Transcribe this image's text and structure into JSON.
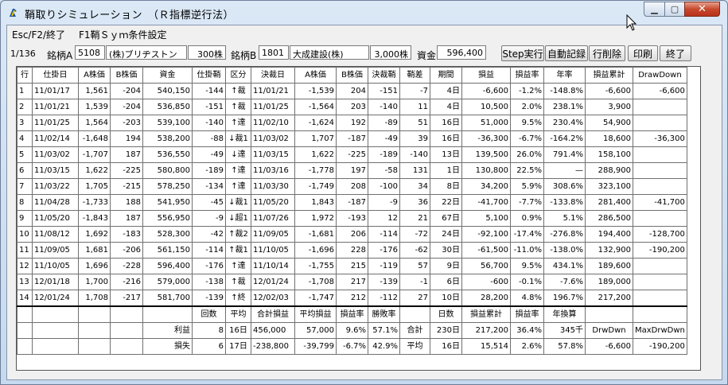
{
  "window": {
    "title": "鞘取りシミュレーション　（Ｒ指標逆行法）",
    "minimize_glyph": "▁",
    "maximize_glyph": "▢",
    "close_glyph": "✕"
  },
  "menu": {
    "items": [
      "Esc/F2/終了",
      "F1鞘Ｓｙｍ条件設定"
    ]
  },
  "info": {
    "counter": "1/136",
    "stock_a_label": "銘柄A",
    "stock_a_code": "5108",
    "stock_a_name": "(株)ブリヂストン",
    "stock_a_shares": "300株",
    "stock_b_label": "銘柄B",
    "stock_b_code": "1801",
    "stock_b_name": "大成建設(株)",
    "stock_b_shares": "3,000株",
    "capital_label": "資金",
    "capital_value": "596,400"
  },
  "toolbar": {
    "step": "Step実行",
    "auto": "自動記録",
    "delete_row": "行削除",
    "print": "印刷",
    "quit": "終了"
  },
  "table": {
    "headers": [
      "行",
      "仕掛日",
      "A株価",
      "B株価",
      "資金",
      "仕掛鞘",
      "区分",
      "決裁日",
      "A株価",
      "B株価",
      "決裁鞘",
      "鞘差",
      "期間",
      "損益",
      "損益率",
      "年率",
      "損益累計",
      "DrawDown"
    ],
    "rows": [
      [
        "1",
        "11/01/17",
        "1,561",
        "-204",
        "540,150",
        "-144",
        "↑裁",
        "11/01/21",
        "-1,539",
        "204",
        "-151",
        "-7",
        "4日",
        "-6,600",
        "-1.2%",
        "-148.8%",
        "-6,600",
        "-6,600"
      ],
      [
        "2",
        "11/01/21",
        "1,539",
        "-204",
        "536,850",
        "-151",
        "↑裁",
        "11/01/25",
        "-1,564",
        "203",
        "-140",
        "11",
        "4日",
        "10,500",
        "2.0%",
        "238.1%",
        "3,900",
        ""
      ],
      [
        "3",
        "11/01/25",
        "1,564",
        "-203",
        "539,100",
        "-140",
        "↑達",
        "11/02/10",
        "-1,624",
        "192",
        "-89",
        "51",
        "16日",
        "51,000",
        "9.5%",
        "230.4%",
        "54,900",
        ""
      ],
      [
        "4",
        "11/02/14",
        "-1,648",
        "194",
        "538,200",
        "-88",
        "↓裁1",
        "11/03/02",
        "1,707",
        "-187",
        "-49",
        "39",
        "16日",
        "-36,300",
        "-6.7%",
        "-164.2%",
        "18,600",
        "-36,300"
      ],
      [
        "5",
        "11/03/02",
        "-1,707",
        "187",
        "536,550",
        "-49",
        "↓達",
        "11/03/15",
        "1,622",
        "-225",
        "-189",
        "-140",
        "13日",
        "139,500",
        "26.0%",
        "791.4%",
        "158,100",
        ""
      ],
      [
        "6",
        "11/03/15",
        "1,622",
        "-225",
        "580,800",
        "-189",
        "↑達",
        "11/03/16",
        "-1,778",
        "197",
        "-58",
        "131",
        "1日",
        "130,800",
        "22.5%",
        "—",
        "288,900",
        ""
      ],
      [
        "7",
        "11/03/22",
        "1,705",
        "-215",
        "578,250",
        "-134",
        "↑達",
        "11/03/30",
        "-1,749",
        "208",
        "-100",
        "34",
        "8日",
        "34,200",
        "5.9%",
        "308.6%",
        "323,100",
        ""
      ],
      [
        "8",
        "11/04/28",
        "-1,733",
        "188",
        "541,950",
        "-45",
        "↓裁1",
        "11/05/20",
        "1,843",
        "-187",
        "-9",
        "36",
        "22日",
        "-41,700",
        "-7.7%",
        "-133.8%",
        "281,400",
        "-41,700"
      ],
      [
        "9",
        "11/05/20",
        "-1,843",
        "187",
        "556,950",
        "-9",
        "↓超1",
        "11/07/26",
        "1,972",
        "-193",
        "12",
        "21",
        "67日",
        "5,100",
        "0.9%",
        "5.1%",
        "286,500",
        ""
      ],
      [
        "10",
        "11/08/12",
        "1,692",
        "-183",
        "528,300",
        "-42",
        "↑裁2",
        "11/09/05",
        "-1,681",
        "206",
        "-114",
        "-72",
        "24日",
        "-92,100",
        "-17.4%",
        "-276.8%",
        "194,400",
        "-128,700"
      ],
      [
        "11",
        "11/09/05",
        "1,681",
        "-206",
        "561,150",
        "-114",
        "↑裁1",
        "11/10/05",
        "-1,696",
        "228",
        "-176",
        "-62",
        "30日",
        "-61,500",
        "-11.0%",
        "-138.0%",
        "132,900",
        "-190,200"
      ],
      [
        "12",
        "11/10/05",
        "1,696",
        "-228",
        "596,400",
        "-176",
        "↑達",
        "11/10/14",
        "-1,755",
        "215",
        "-119",
        "57",
        "9日",
        "56,700",
        "9.5%",
        "434.1%",
        "189,600",
        ""
      ],
      [
        "13",
        "12/01/18",
        "1,700",
        "-216",
        "579,000",
        "-138",
        "↑裁",
        "12/01/24",
        "-1,708",
        "217",
        "-139",
        "-1",
        "6日",
        "-600",
        "-0.1%",
        "-7.6%",
        "189,000",
        ""
      ],
      [
        "14",
        "12/01/24",
        "1,708",
        "-217",
        "581,700",
        "-139",
        "↑終",
        "12/02/03",
        "-1,747",
        "212",
        "-112",
        "27",
        "10日",
        "28,200",
        "4.8%",
        "196.7%",
        "217,200",
        ""
      ]
    ],
    "summary_header": [
      "",
      "",
      "",
      "",
      "",
      "回数",
      "平均",
      "合計損益",
      "平均損益",
      "損益率",
      "勝敗率",
      "",
      "日数",
      "損益累計",
      "損益率",
      "年換算",
      "",
      ""
    ],
    "summary_profit": [
      "",
      "",
      "",
      "",
      "利益",
      "8",
      "16日",
      "456,000",
      "57,000",
      "9.6%",
      "57.1%",
      "合計",
      "230日",
      "217,200",
      "36.4%",
      "345千",
      "DrwDwn",
      "MaxDrwDwn"
    ],
    "summary_loss": [
      "",
      "",
      "",
      "",
      "損失",
      "6",
      "17日",
      "-238,800",
      "-39,799",
      "-6.7%",
      "42.9%",
      "平均",
      "16日",
      "15,514",
      "2.6%",
      "57.8%",
      "-6,600",
      "-190,200"
    ]
  }
}
